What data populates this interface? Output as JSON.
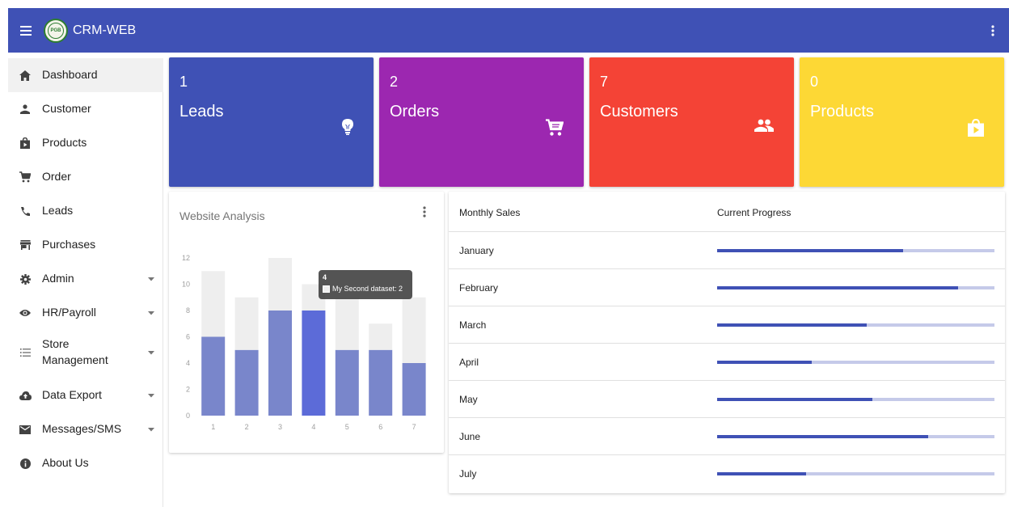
{
  "app": {
    "title": "CRM-WEB",
    "logo_text": "PGB",
    "theme_color": "#3f51b5"
  },
  "sidebar": {
    "items": [
      {
        "label": "Dashboard",
        "icon": "home-icon",
        "active": true,
        "caret": false
      },
      {
        "label": "Customer",
        "icon": "person-icon",
        "active": false,
        "caret": false
      },
      {
        "label": "Products",
        "icon": "shopping-bag-icon",
        "active": false,
        "caret": false
      },
      {
        "label": "Order",
        "icon": "cart-icon",
        "active": false,
        "caret": false
      },
      {
        "label": "Leads",
        "icon": "phone-icon",
        "active": false,
        "caret": false
      },
      {
        "label": "Purchases",
        "icon": "store-icon",
        "active": false,
        "caret": false
      },
      {
        "label": "Admin",
        "icon": "gear-icon",
        "active": false,
        "caret": true
      },
      {
        "label": "HR/Payroll",
        "icon": "eye-icon",
        "active": false,
        "caret": true
      },
      {
        "label": "Store Management",
        "icon": "list-icon",
        "active": false,
        "caret": true
      },
      {
        "label": "Data Export",
        "icon": "cloud-upload-icon",
        "active": false,
        "caret": true
      },
      {
        "label": "Messages/SMS",
        "icon": "mail-icon",
        "active": false,
        "caret": true
      },
      {
        "label": "About Us",
        "icon": "info-icon",
        "active": false,
        "caret": false
      }
    ]
  },
  "stats": [
    {
      "count": "1",
      "label": "Leads",
      "color": "#3f51b5",
      "icon": "lightbulb-icon"
    },
    {
      "count": "2",
      "label": "Orders",
      "color": "#9c27b0",
      "icon": "cart-icon"
    },
    {
      "count": "7",
      "label": "Customers",
      "color": "#f44336",
      "icon": "people-icon"
    },
    {
      "count": "0",
      "label": "Products",
      "color": "#fdd835",
      "icon": "shopping-bag-icon"
    }
  ],
  "analysis": {
    "title": "Website Analysis",
    "tooltip": {
      "title": "4",
      "label": "My Second dataset: 2"
    }
  },
  "chart_data": {
    "type": "bar",
    "categories": [
      "1",
      "2",
      "3",
      "4",
      "5",
      "6",
      "7"
    ],
    "series": [
      {
        "name": "",
        "values": [
          6,
          5,
          8,
          8,
          5,
          5,
          4
        ],
        "color": "#7986cb"
      },
      {
        "name": "My Second dataset",
        "values": [
          5,
          4,
          4,
          2,
          4,
          2,
          5
        ],
        "color": "#eeeeee"
      }
    ],
    "stacked": true,
    "yticks": [
      0,
      2,
      4,
      6,
      8,
      10,
      12
    ],
    "ylim": [
      0,
      12
    ],
    "highlight_index": 3,
    "highlight_color": "#5c6bd8",
    "grid": false
  },
  "sales": {
    "headers": [
      "Monthly Sales",
      "Current Progress"
    ],
    "rows": [
      {
        "month": "January",
        "progress": 0.67
      },
      {
        "month": "February",
        "progress": 0.87
      },
      {
        "month": "March",
        "progress": 0.54
      },
      {
        "month": "April",
        "progress": 0.34
      },
      {
        "month": "May",
        "progress": 0.56
      },
      {
        "month": "June",
        "progress": 0.76
      },
      {
        "month": "July",
        "progress": 0.32
      }
    ]
  }
}
